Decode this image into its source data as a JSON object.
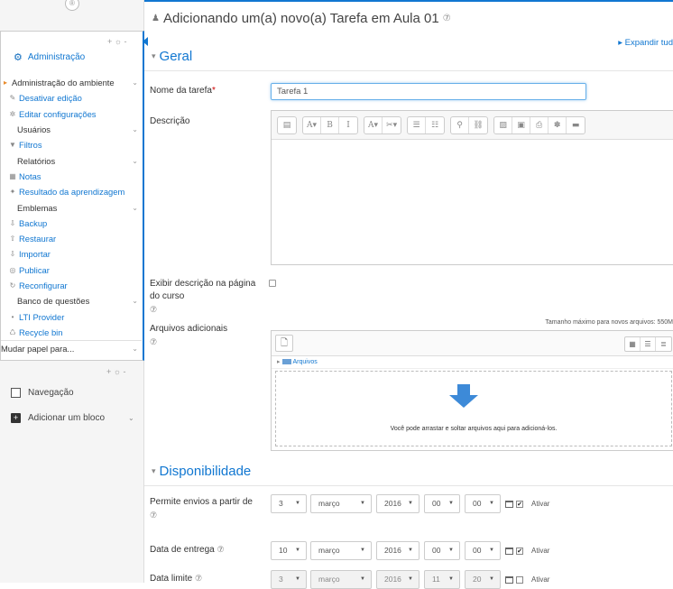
{
  "sidebar": {
    "top_icon": "®",
    "block_controls": "+ ☼ -",
    "admin_title": "Administração",
    "items": [
      {
        "label": "Administração do ambiente",
        "icon": "caret-icon",
        "glyph": "▸",
        "cat": true,
        "chevron": true
      },
      {
        "label": "Desativar edição",
        "icon": "pencil-icon",
        "glyph": "✎"
      },
      {
        "label": "Editar configurações",
        "icon": "gear-icon",
        "glyph": "✲"
      },
      {
        "label": "Usuários",
        "cat": true,
        "chevron": true
      },
      {
        "label": "Filtros",
        "icon": "filter-icon",
        "glyph": "▼"
      },
      {
        "label": "Relatórios",
        "cat": true,
        "chevron": true
      },
      {
        "label": "Notas",
        "icon": "grades-icon",
        "glyph": "▦"
      },
      {
        "label": "Resultado da aprendizagem",
        "icon": "outcome-icon",
        "glyph": "✦"
      },
      {
        "label": "Emblemas",
        "cat": true,
        "chevron": true
      },
      {
        "label": "Backup",
        "icon": "backup-icon",
        "glyph": "⇩"
      },
      {
        "label": "Restaurar",
        "icon": "restore-icon",
        "glyph": "⇧"
      },
      {
        "label": "Importar",
        "icon": "import-icon",
        "glyph": "⇩"
      },
      {
        "label": "Publicar",
        "icon": "publish-icon",
        "glyph": "◎"
      },
      {
        "label": "Reconfigurar",
        "icon": "reset-icon",
        "glyph": "↻"
      },
      {
        "label": "Banco de questões",
        "cat": true,
        "chevron": true
      },
      {
        "label": "LTI Provider",
        "icon": "dot-icon",
        "glyph": "•"
      },
      {
        "label": "Recycle bin",
        "icon": "recycle-icon",
        "glyph": "♺"
      },
      {
        "label": "Mudar papel para...",
        "cat": true,
        "chevron": true,
        "divider": true
      }
    ],
    "lower_controls": "+ ☼ -",
    "navegacao": "Navegação",
    "adicionar_bloco": "Adicionar um bloco"
  },
  "main": {
    "page_title": "Adicionando um(a) novo(a) Tarefa em Aula 01",
    "expand_all": "▸ Expandir tud",
    "section_geral": "Geral",
    "label_nome": "Nome da tarefa",
    "required_mark": "*",
    "nome_value": "Tarefa 1",
    "label_descricao": "Descrição",
    "editor_buttons": [
      [
        "▤"
      ],
      [
        "A▾",
        "B",
        "I"
      ],
      [
        "A▾",
        "✂▾"
      ],
      [
        "☰",
        "☷"
      ],
      [
        "⚲",
        "⛓"
      ],
      [
        "▨",
        "▣",
        "⎙",
        "✽",
        "▬"
      ]
    ],
    "label_exibir": "Exibir descrição na página do curso",
    "label_arquivos": "Arquivos adicionais",
    "max_size": "Tamanho máximo para novos arquivos: 550M",
    "fp_path": "Arquivos",
    "drop_text": "Você pode arrastar e soltar arquivos aqui para adicioná-los.",
    "section_disp": "Disponibilidade",
    "label_permite": "Permite envios a partir de",
    "label_entrega": "Data de entrega",
    "label_limite": "Data limite",
    "rows": [
      {
        "day": "3",
        "month": "março",
        "year": "2016",
        "hour": "00",
        "min": "00",
        "checked": true,
        "ativar": "Ativar"
      },
      {
        "day": "10",
        "month": "março",
        "year": "2016",
        "hour": "00",
        "min": "00",
        "checked": true,
        "ativar": "Ativar"
      },
      {
        "day": "3",
        "month": "março",
        "year": "2016",
        "hour": "11",
        "min": "20",
        "checked": false,
        "ativar": "Ativar"
      }
    ]
  },
  "icons": {
    "help": "⑦",
    "info": "⑦",
    "caret_down": "▾"
  }
}
